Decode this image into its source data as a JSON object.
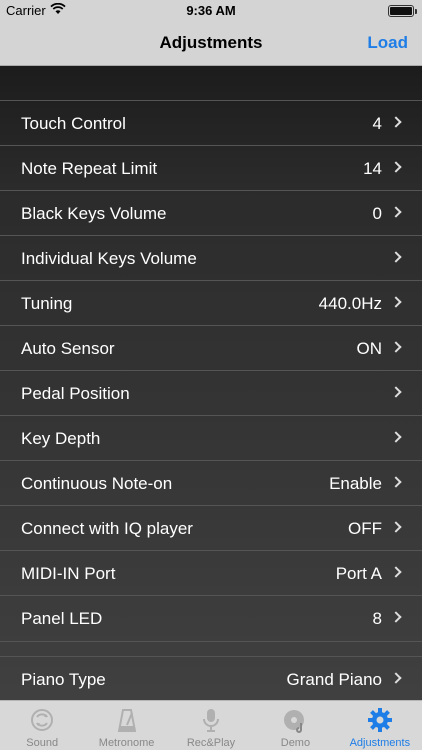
{
  "status": {
    "carrier": "Carrier",
    "time": "9:36 AM"
  },
  "nav": {
    "title": "Adjustments",
    "load_label": "Load"
  },
  "settings": [
    {
      "label": "Touch Control",
      "value": "4"
    },
    {
      "label": "Note Repeat Limit",
      "value": "14"
    },
    {
      "label": "Black Keys Volume",
      "value": "0"
    },
    {
      "label": "Individual Keys Volume",
      "value": ""
    },
    {
      "label": "Tuning",
      "value": "440.0Hz"
    },
    {
      "label": "Auto Sensor",
      "value": "ON"
    },
    {
      "label": "Pedal Position",
      "value": ""
    },
    {
      "label": "Key Depth",
      "value": ""
    },
    {
      "label": "Continuous Note-on",
      "value": "Enable"
    },
    {
      "label": "Connect with IQ player",
      "value": "OFF"
    },
    {
      "label": "MIDI-IN Port",
      "value": "Port A"
    },
    {
      "label": "Panel LED",
      "value": "8"
    }
  ],
  "settings2": [
    {
      "label": "Piano Type",
      "value": "Grand Piano"
    }
  ],
  "tabs": [
    {
      "label": "Sound",
      "icon": "sound-icon"
    },
    {
      "label": "Metronome",
      "icon": "metronome-icon"
    },
    {
      "label": "Rec&Play",
      "icon": "microphone-icon"
    },
    {
      "label": "Demo",
      "icon": "disc-icon"
    },
    {
      "label": "Adjustments",
      "icon": "gear-icon"
    }
  ],
  "colors": {
    "accent": "#1e7de6",
    "tab_inactive": "#888888"
  }
}
